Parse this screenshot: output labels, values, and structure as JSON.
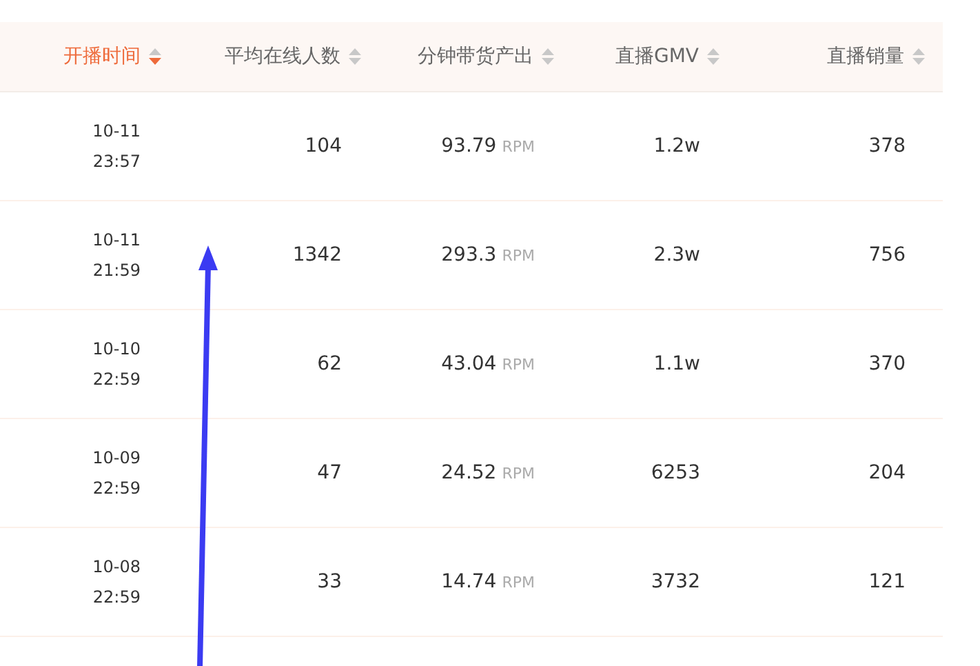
{
  "table": {
    "columns": [
      {
        "label": "开播时间",
        "sorted_descending": true
      },
      {
        "label": "平均在线人数",
        "sorted_descending": false
      },
      {
        "label": "分钟带货产出",
        "sorted_descending": false
      },
      {
        "label": "直播GMV",
        "sorted_descending": false
      },
      {
        "label": "直播销量",
        "sorted_descending": false
      }
    ],
    "rows": [
      {
        "date": "10-11",
        "time": "23:57",
        "avg_online": "104",
        "output": "93.79",
        "unit": "RPM",
        "gmv": "1.2w",
        "sales": "378"
      },
      {
        "date": "10-11",
        "time": "21:59",
        "avg_online": "1342",
        "output": "293.3",
        "unit": "RPM",
        "gmv": "2.3w",
        "sales": "756"
      },
      {
        "date": "10-10",
        "time": "22:59",
        "avg_online": "62",
        "output": "43.04",
        "unit": "RPM",
        "gmv": "1.1w",
        "sales": "370"
      },
      {
        "date": "10-09",
        "time": "22:59",
        "avg_online": "47",
        "output": "24.52",
        "unit": "RPM",
        "gmv": "6253",
        "sales": "204"
      },
      {
        "date": "10-08",
        "time": "22:59",
        "avg_online": "33",
        "output": "14.74",
        "unit": "RPM",
        "gmv": "3732",
        "sales": "121"
      }
    ]
  },
  "annotation": {
    "kind": "arrow"
  }
}
